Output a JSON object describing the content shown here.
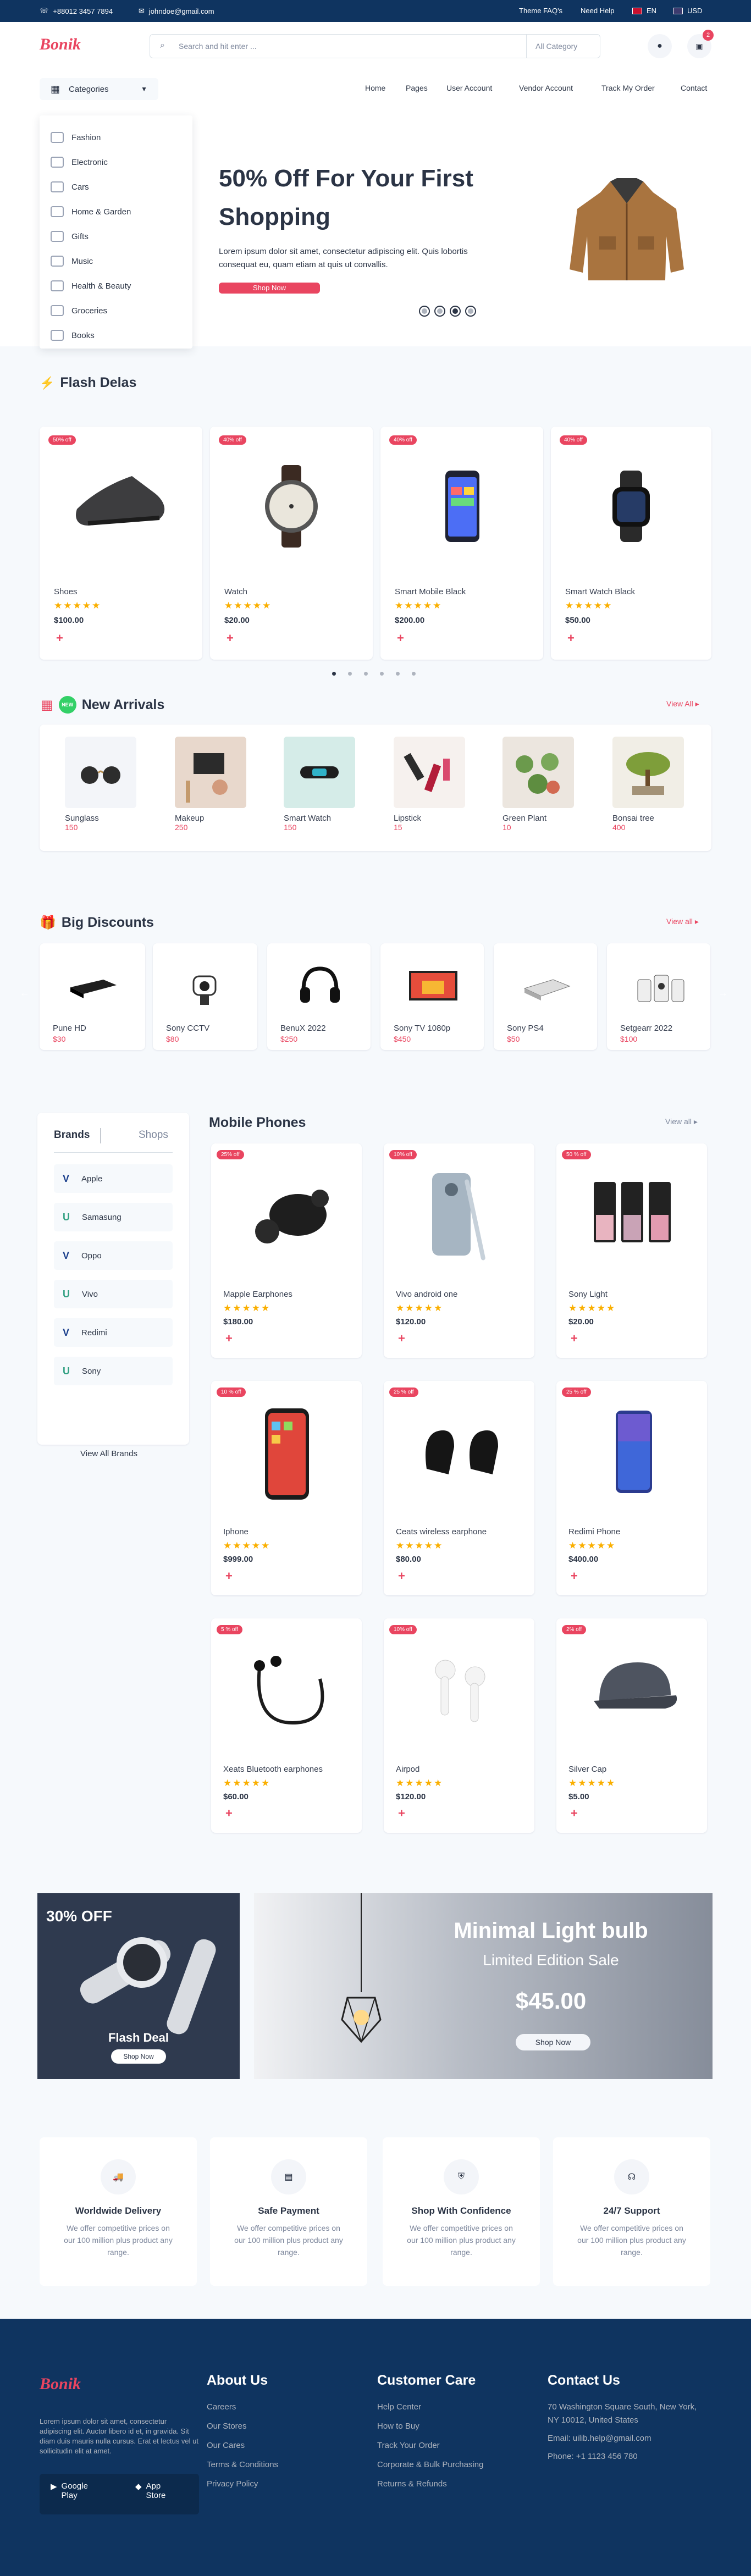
{
  "topbar": {
    "phone": "+88012 3457 7894",
    "email": "johndoe@gmail.com",
    "faq": "Theme FAQ's",
    "help": "Need Help",
    "lang": "EN",
    "currency": "USD"
  },
  "header": {
    "logo": "Bonik",
    "search_placeholder": "Search and hit enter ...",
    "search_category": "All Category",
    "cart_count": "2"
  },
  "nav": {
    "categories_label": "Categories",
    "links": [
      "Home",
      "Pages",
      "User Account",
      "Vendor Account",
      "Track My Order",
      "Contact"
    ]
  },
  "category_menu": [
    "Fashion",
    "Electronic",
    "Cars",
    "Home & Garden",
    "Gifts",
    "Music",
    "Health & Beauty",
    "Groceries",
    "Books"
  ],
  "hero": {
    "title_line1": "50% Off For Your First",
    "title_line2": "Shopping",
    "desc_line1": "Lorem ipsum dolor sit amet, consectetur adipiscing elit. Quis lobortis",
    "desc_line2": "consequat eu, quam etiam at quis ut convallis.",
    "button": "Shop Now",
    "active_slide": 3
  },
  "flash": {
    "title": "Flash Delas",
    "products": [
      {
        "badge": "50% off",
        "name": "Shoes",
        "price": "$100.00"
      },
      {
        "badge": "40% off",
        "name": "Watch",
        "price": "$20.00"
      },
      {
        "badge": "40% off",
        "name": "Smart Mobile Black",
        "price": "$200.00"
      },
      {
        "badge": "40% off",
        "name": "Smart Watch Black",
        "price": "$50.00"
      }
    ]
  },
  "arrivals": {
    "title": "New Arrivals",
    "view_all": "View All",
    "items": [
      {
        "name": "Sunglass",
        "price": "150"
      },
      {
        "name": "Makeup",
        "price": "250"
      },
      {
        "name": "Smart Watch",
        "price": "150"
      },
      {
        "name": "Lipstick",
        "price": "15"
      },
      {
        "name": "Green Plant",
        "price": "10"
      },
      {
        "name": "Bonsai tree",
        "price": "400"
      }
    ]
  },
  "discounts": {
    "title": "Big Discounts",
    "view_all": "View all",
    "items": [
      {
        "name": "Pune HD",
        "price": "$30"
      },
      {
        "name": "Sony CCTV",
        "price": "$80"
      },
      {
        "name": "BenuX 2022",
        "price": "$250"
      },
      {
        "name": "Sony TV 1080p",
        "price": "$450"
      },
      {
        "name": "Sony PS4",
        "price": "$50"
      },
      {
        "name": "Setgearr 2022",
        "price": "$100"
      }
    ]
  },
  "brands": {
    "tab_brands": "Brands",
    "tab_shops": "Shops",
    "list": [
      "Apple",
      "Samasung",
      "Oppo",
      "Vivo",
      "Redimi",
      "Sony"
    ],
    "view_all": "View All Brands"
  },
  "mobile": {
    "title": "Mobile Phones",
    "view_all": "View all",
    "products": [
      {
        "badge": "25% off",
        "name": "Mapple Earphones",
        "price": "$180.00"
      },
      {
        "badge": "10% off",
        "name": "Vivo android one",
        "price": "$120.00"
      },
      {
        "badge": "50 % off",
        "name": "Sony Light",
        "price": "$20.00"
      },
      {
        "badge": "10 % off",
        "name": "Iphone",
        "price": "$999.00"
      },
      {
        "badge": "25 % off",
        "name": "Ceats wireless earphone",
        "price": "$80.00"
      },
      {
        "badge": "25 % off",
        "name": "Redimi Phone",
        "price": "$400.00"
      },
      {
        "badge": "5 % off",
        "name": "Xeats Bluetooth earphones",
        "price": "$60.00"
      },
      {
        "badge": "10% off",
        "name": "Airpod",
        "price": "$120.00"
      },
      {
        "badge": "2% off",
        "name": "Silver Cap",
        "price": "$5.00"
      }
    ]
  },
  "promo": {
    "left_discount": "30% OFF",
    "left_title": "Flash Deal",
    "left_button": "Shop Now",
    "right_title": "Minimal  Light bulb",
    "right_sub": "Limited Edition Sale",
    "right_price": "$45.00",
    "right_button": "Shop Now"
  },
  "features": [
    {
      "title": "Worldwide Delivery",
      "text": "We offer competitive prices on our 100 million plus product any range."
    },
    {
      "title": "Safe Payment",
      "text": "We offer competitive prices on our 100 million plus product any range."
    },
    {
      "title": "Shop With Confidence",
      "text": "We offer competitive prices on our 100 million plus product any range."
    },
    {
      "title": "24/7 Support",
      "text": "We offer competitive prices on our 100 million plus product any range."
    }
  ],
  "footer": {
    "logo": "Bonik",
    "about_text": "Lorem ipsum dolor sit amet, consectetur adipiscing elit. Auctor libero id et, in gravida. Sit diam duis mauris nulla cursus. Erat et lectus vel ut sollicitudin elit at amet.",
    "google": "Google Play",
    "apple": "App Store",
    "about_title": "About Us",
    "about_links": [
      "Careers",
      "Our Stores",
      "Our Cares",
      "Terms & Conditions",
      "Privacy Policy"
    ],
    "care_title": "Customer Care",
    "care_links": [
      "Help Center",
      "How to Buy",
      "Track Your Order",
      "Corporate & Bulk Purchasing",
      "Returns & Refunds"
    ],
    "contact_title": "Contact Us",
    "address": "70 Washington Square South, New York, NY 10012, United States",
    "email": "Email: uilib.help@gmail.com",
    "phone": "Phone: +1 1123 456 780"
  },
  "colors": {
    "primary": "#e94560",
    "navy": "#0f3460",
    "text": "#2b3445",
    "star": "#faaf00"
  }
}
